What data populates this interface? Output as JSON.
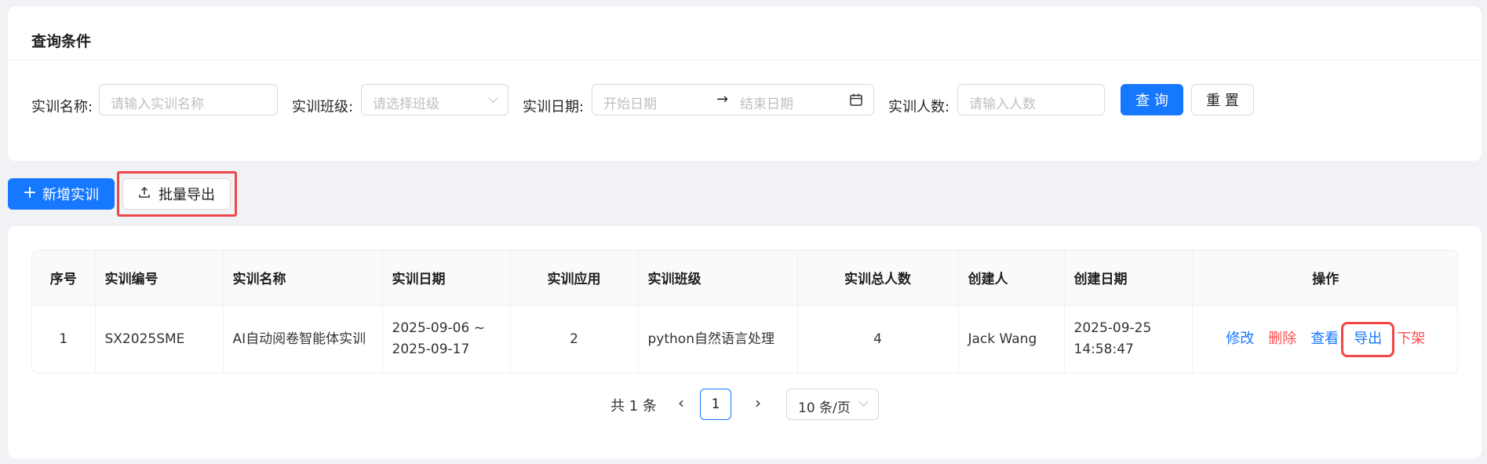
{
  "query": {
    "title": "查询条件",
    "fields": {
      "name_label": "实训名称:",
      "name_placeholder": "请输入实训名称",
      "class_label": "实训班级:",
      "class_placeholder": "请选择班级",
      "date_label": "实训日期:",
      "date_start_placeholder": "开始日期",
      "date_end_placeholder": "结束日期",
      "count_label": "实训人数:",
      "count_placeholder": "请输入人数"
    },
    "search_button": "查 询",
    "reset_button": "重 置"
  },
  "toolbar": {
    "add_button": "新增实训",
    "export_button": "批量导出"
  },
  "table": {
    "columns": [
      "序号",
      "实训编号",
      "实训名称",
      "实训日期",
      "实训应用",
      "实训班级",
      "实训总人数",
      "创建人",
      "创建日期",
      "操作"
    ],
    "rows": [
      {
        "index": "1",
        "code": "SX2025SME",
        "name": "AI自动阅卷智能体实训",
        "date_start": "2025-09-06 ~",
        "date_end": "2025-09-17",
        "apps": "2",
        "class": "python自然语言处理",
        "total": "4",
        "creator": "Jack Wang",
        "created_date": "2025-09-25",
        "created_time": "14:58:47",
        "actions": {
          "edit": "修改",
          "delete": "删除",
          "view": "查看",
          "export": "导出",
          "unlist": "下架"
        }
      }
    ]
  },
  "pagination": {
    "total": "共 1 条",
    "current_page": "1",
    "page_size": "10 条/页"
  },
  "colors": {
    "primary": "#1677ff",
    "danger": "#ff4d4f",
    "highlight": "#f04747"
  }
}
